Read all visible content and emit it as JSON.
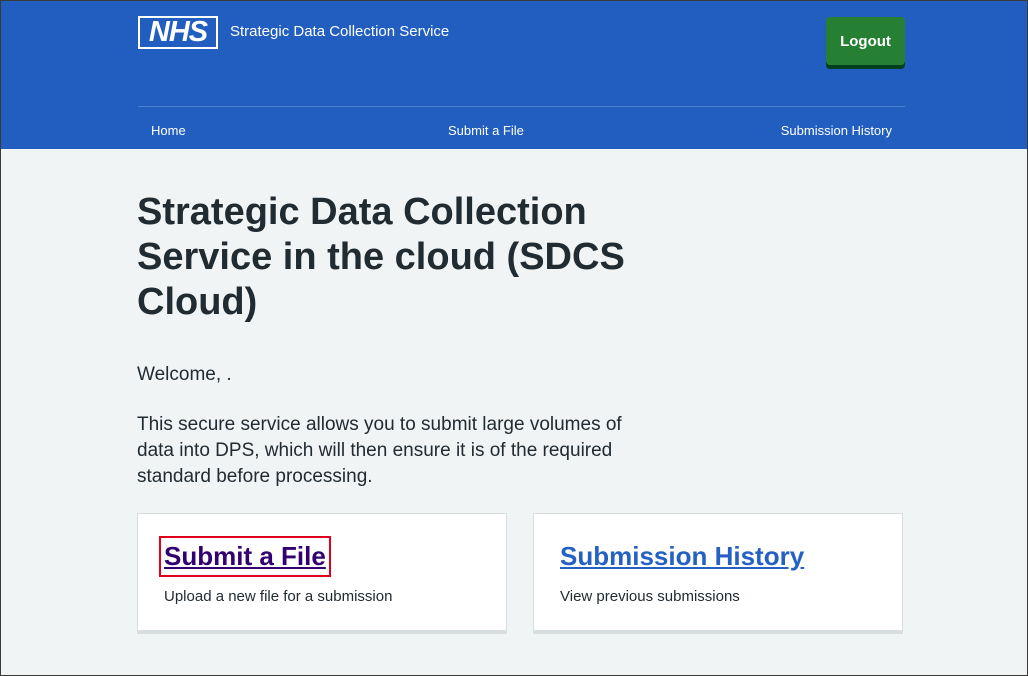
{
  "header": {
    "logo_text": "NHS",
    "service_name": "Strategic Data Collection Service",
    "logout_label": "Logout"
  },
  "nav": {
    "items": [
      {
        "label": "Home"
      },
      {
        "label": "Submit a File"
      },
      {
        "label": "Submission History"
      }
    ]
  },
  "main": {
    "title": "Strategic Data Collection Service in the cloud (SDCS Cloud)",
    "welcome": "Welcome, .",
    "intro": "This secure service allows you to submit large volumes of data into DPS, which will then ensure it is of the required standard before processing."
  },
  "cards": [
    {
      "title": "Submit a File",
      "description": "Upload a new file for a submission"
    },
    {
      "title": "Submission History",
      "description": "View previous submissions"
    }
  ],
  "colors": {
    "header_bg": "#225ebf",
    "logout_bg": "#268033",
    "visited_link": "#330072",
    "link": "#2561c4",
    "highlight_box": "#e0001b",
    "page_bg": "#f0f4f5"
  }
}
